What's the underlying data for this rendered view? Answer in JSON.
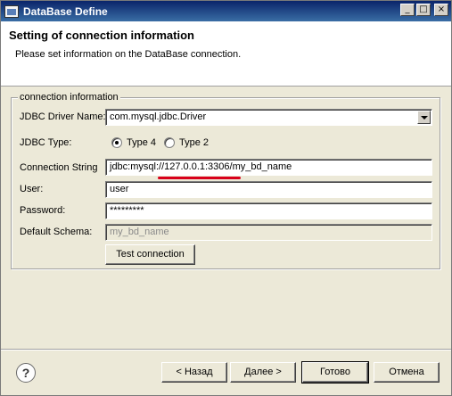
{
  "window": {
    "title": "DataBase Define",
    "controls": {
      "minimize": "_",
      "maximize": "□",
      "close": "×"
    }
  },
  "header": {
    "title": "Setting of connection information",
    "description": "Please set information on the DataBase connection."
  },
  "group": {
    "legend": "connection information"
  },
  "form": {
    "jdbc_driver_label": "JDBC Driver Name:",
    "jdbc_driver_value": "com.mysql.jdbc.Driver",
    "jdbc_type_label": "JDBC Type:",
    "type4_label": "Type 4",
    "type2_label": "Type 2",
    "connection_string_label": "Connection String",
    "connection_string_value": "jdbc:mysql://127.0.0.1:3306/my_bd_name",
    "user_label": "User:",
    "user_value": "user",
    "password_label": "Password:",
    "password_value": "*********",
    "default_schema_label": "Default Schema:",
    "default_schema_value": "my_bd_name",
    "test_connection_label": "Test connection"
  },
  "footer": {
    "help_label": "?",
    "back_label": "< Назад",
    "next_label": "Далее >",
    "finish_label": "Готово",
    "cancel_label": "Отмена"
  },
  "colors": {
    "titlebar": "#0a246a",
    "dialog_bg": "#ece9d8",
    "highlight_mark": "#d9001b"
  },
  "icons": [
    "app-icon",
    "minimize-icon",
    "maximize-icon",
    "close-icon",
    "dropdown-arrow-icon",
    "help-icon"
  ]
}
